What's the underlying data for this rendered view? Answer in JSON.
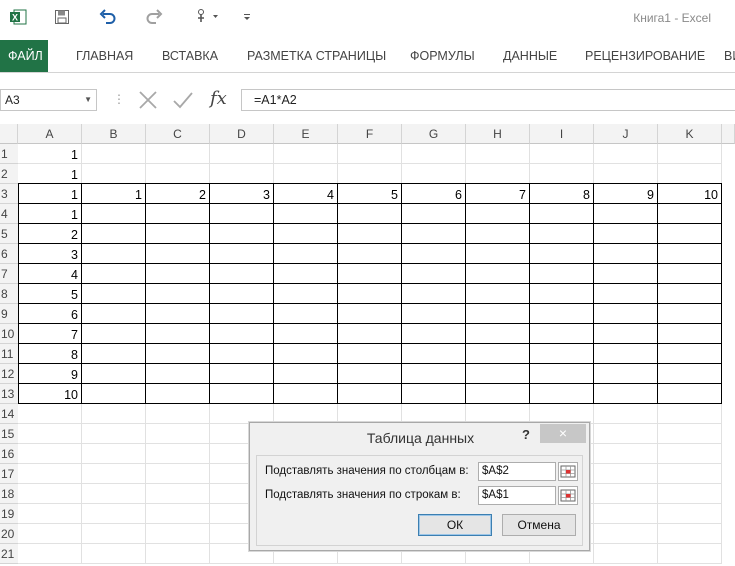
{
  "titlebar": {
    "app_title": "Книга1 - Excel",
    "icons": [
      "excel-icon",
      "save-icon",
      "undo-icon",
      "redo-icon",
      "touch-mode-icon",
      "customize-qat-icon"
    ],
    "accent": "#217346"
  },
  "ribbon": {
    "tabs": [
      {
        "label": "ФАЙЛ"
      },
      {
        "label": "ГЛАВНАЯ"
      },
      {
        "label": "ВСТАВКА"
      },
      {
        "label": "РАЗМЕТКА СТРАНИЦЫ"
      },
      {
        "label": "ФОРМУЛЫ"
      },
      {
        "label": "ДАННЫЕ"
      },
      {
        "label": "РЕЦЕНЗИРОВАНИЕ"
      },
      {
        "label": "ВИ"
      }
    ]
  },
  "formula_bar": {
    "name_box": "A3",
    "formula": "=A1*A2",
    "fx_label": "fx"
  },
  "sheet": {
    "columns": [
      "A",
      "B",
      "C",
      "D",
      "E",
      "F",
      "G",
      "H",
      "I",
      "J",
      "K"
    ],
    "rows": [
      "1",
      "2",
      "3",
      "4",
      "5",
      "6",
      "7",
      "8",
      "9",
      "10",
      "11",
      "12",
      "13",
      "14",
      "15",
      "16",
      "17",
      "18",
      "19",
      "20",
      "21"
    ],
    "cells": {
      "A1": "1",
      "A2": "1",
      "A3": "1",
      "B3": "1",
      "C3": "2",
      "D3": "3",
      "E3": "4",
      "F3": "5",
      "G3": "6",
      "H3": "7",
      "I3": "8",
      "J3": "9",
      "K3": "10",
      "A4": "1",
      "A5": "2",
      "A6": "3",
      "A7": "4",
      "A8": "5",
      "A9": "6",
      "A10": "7",
      "A11": "8",
      "A12": "9",
      "A13": "10"
    }
  },
  "dialog": {
    "title": "Таблица данных",
    "help": "?",
    "close": "×",
    "column_label": "Подставлять значения по столбцам в:",
    "column_value": "$A$2",
    "row_label": "Подставлять значения по строкам в:",
    "row_value": "$A$1",
    "ok_label": "ОК",
    "cancel_label": "Отмена"
  }
}
